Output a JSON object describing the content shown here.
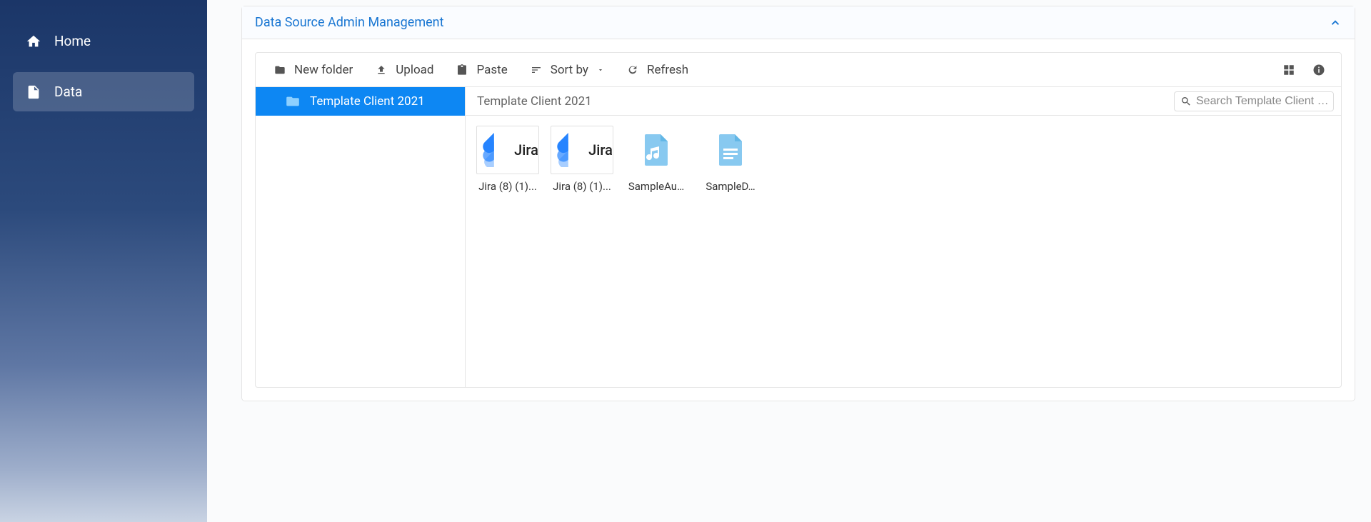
{
  "sidebar": {
    "items": [
      {
        "label": "Home",
        "icon": "home",
        "active": false
      },
      {
        "label": "Data",
        "icon": "file",
        "active": true
      }
    ]
  },
  "panel": {
    "title": "Data Source Admin Management"
  },
  "toolbar": {
    "new_folder": "New folder",
    "upload": "Upload",
    "paste": "Paste",
    "sort_by": "Sort by",
    "refresh": "Refresh"
  },
  "tree": {
    "items": [
      {
        "label": "Template Client 2021",
        "selected": true
      }
    ]
  },
  "breadcrumb": {
    "path": "Template Client 2021"
  },
  "search": {
    "placeholder": "Search Template Client …"
  },
  "files": [
    {
      "name": "Jira (8) (1)...",
      "type": "jira"
    },
    {
      "name": "Jira (8) (1)...",
      "type": "jira"
    },
    {
      "name": "SampleAu…",
      "type": "audio"
    },
    {
      "name": "SampleD…",
      "type": "doc"
    }
  ]
}
